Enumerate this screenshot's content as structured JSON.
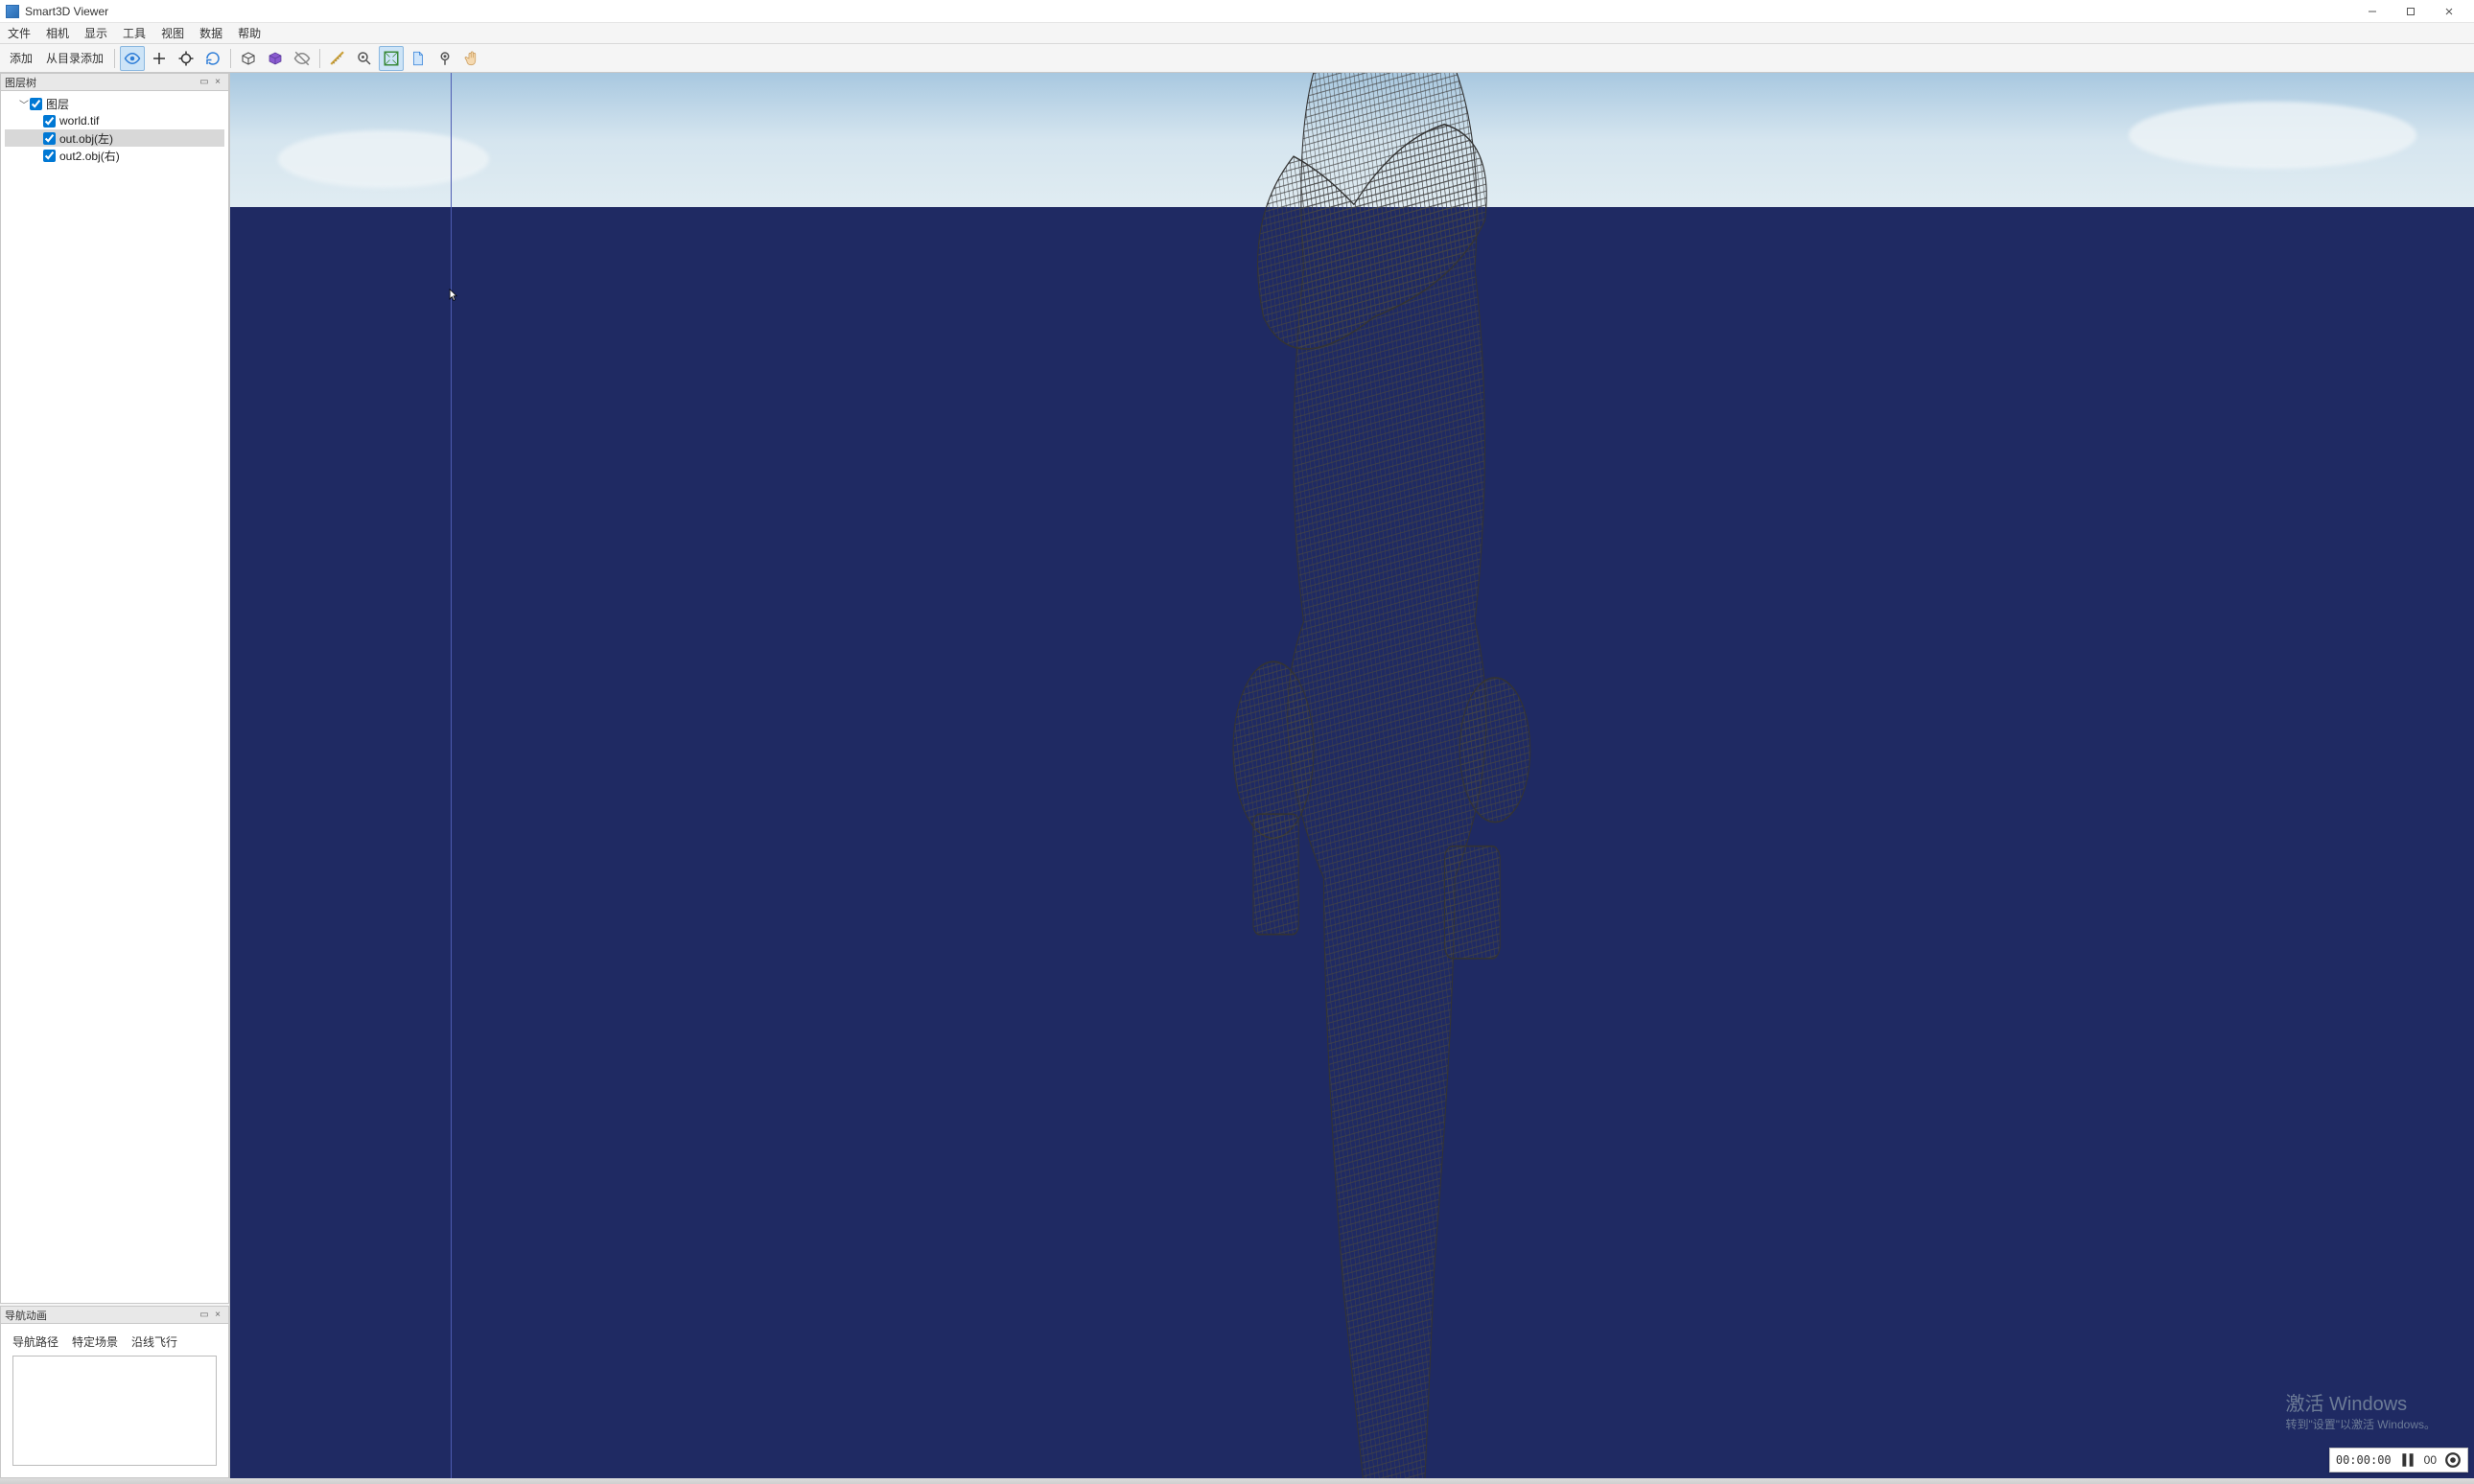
{
  "window": {
    "title": "Smart3D Viewer"
  },
  "menu": {
    "items": [
      "文件",
      "相机",
      "显示",
      "工具",
      "视图",
      "数据",
      "帮助"
    ]
  },
  "toolbar": {
    "add_label": "添加",
    "add_from_dir_label": "从目录添加"
  },
  "panels": {
    "layers_title": "图层树",
    "nav_title": "导航动画"
  },
  "tree": {
    "root_label": "图层",
    "items": [
      {
        "label": "world.tif",
        "checked": true,
        "selected": false
      },
      {
        "label": "out.obj(左)",
        "checked": true,
        "selected": true
      },
      {
        "label": "out2.obj(右)",
        "checked": true,
        "selected": false
      }
    ]
  },
  "nav_tabs": [
    "导航路径",
    "特定场景",
    "沿线飞行"
  ],
  "watermark": {
    "line1": "激活 Windows",
    "line2": "转到\"设置\"以激活 Windows。"
  },
  "recorder": {
    "time": "00:00:00",
    "fps": "00"
  }
}
